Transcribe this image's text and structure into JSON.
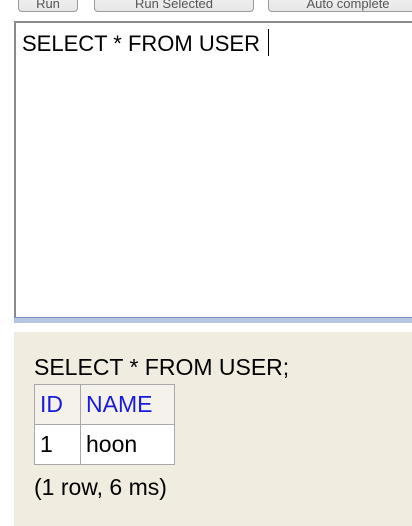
{
  "toolbar": {
    "buttons": [
      {
        "label": "Run"
      },
      {
        "label": "Run Selected"
      },
      {
        "label": "Auto complete"
      }
    ]
  },
  "editor": {
    "text": "SELECT * FROM USER "
  },
  "results": {
    "query": "SELECT * FROM USER;",
    "columns": [
      "ID",
      "NAME"
    ],
    "rows": [
      [
        "1",
        "hoon"
      ]
    ],
    "summary": "(1 row, 6 ms)"
  }
}
